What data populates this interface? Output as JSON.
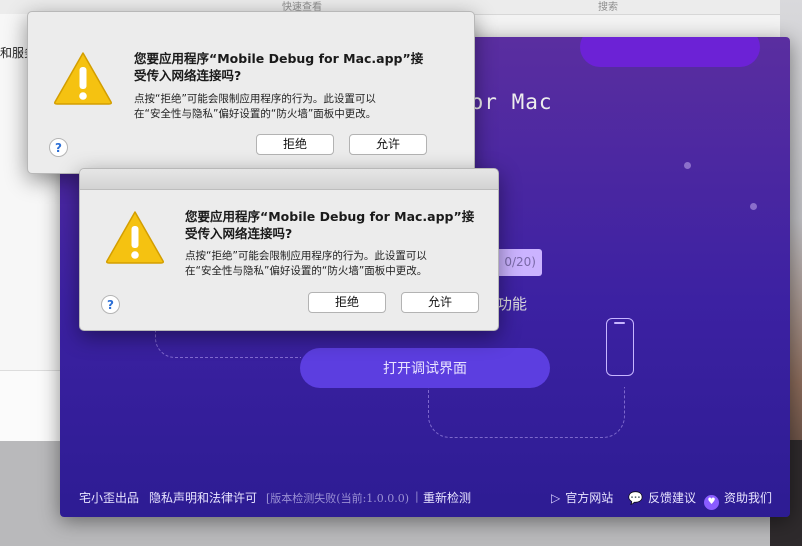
{
  "background_window": {
    "toolbar_left": "快速查看",
    "toolbar_right": "搜索",
    "sidebar_fragment": "和服务"
  },
  "app": {
    "title": "for Mac",
    "version_fragment": "0/20)",
    "function_label": "功能",
    "open_button": "打开调试界面",
    "footer": {
      "author": "宅小歪出品",
      "privacy": "隐私声明和法律许可",
      "version_status": "[版本检测失败(当前:1.0.0.0)",
      "separator": "|",
      "recheck": "重新检测",
      "website": "官方网站",
      "feedback": "反馈建议",
      "donate": "资助我们"
    }
  },
  "dialogs": [
    {
      "message_line1": "您要应用程序“Mobile Debug for Mac.app”接",
      "message_line2": "受传入网络连接吗?",
      "info_line1": "点按“拒绝”可能会限制应用程序的行为。此设置可以",
      "info_line2": "在“安全性与隐私”偏好设置的“防火墙”面板中更改。",
      "deny": "拒绝",
      "allow": "允许",
      "help": "?"
    },
    {
      "message_line1": "您要应用程序“Mobile Debug for Mac.app”接",
      "message_line2": "受传入网络连接吗?",
      "info_line1": "点按“拒绝”可能会限制应用程序的行为。此设置可以",
      "info_line2": "在“安全性与隐私”偏好设置的“防火墙”面板中更改。",
      "deny": "拒绝",
      "allow": "允许",
      "help": "?"
    }
  ],
  "icons": {
    "warning": "warning-triangle-icon",
    "website": "play-icon",
    "feedback": "chat-bubble-icon",
    "donate": "donate-icon"
  },
  "colors": {
    "app_bg": "#3c21a2",
    "accent": "#5c3ee0",
    "warning_yellow": "#f5c211"
  }
}
